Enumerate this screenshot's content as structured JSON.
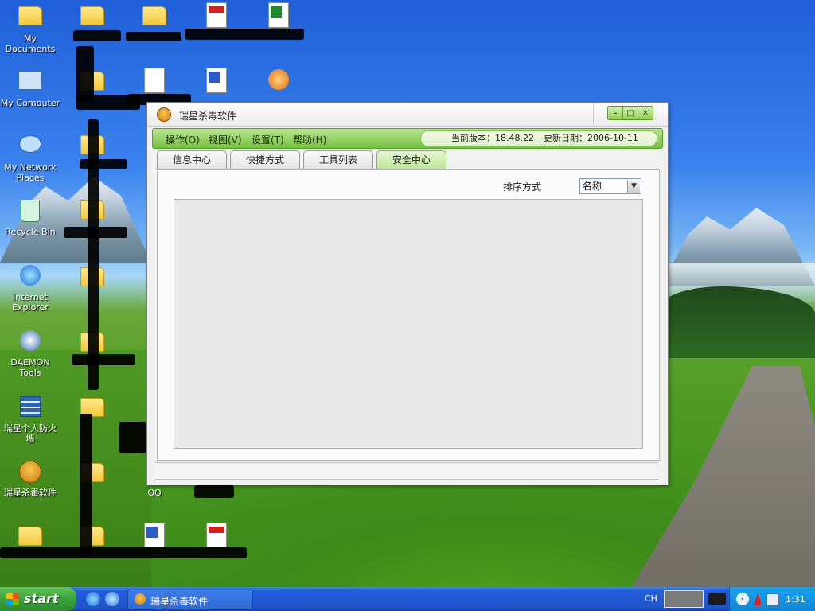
{
  "desktop": {
    "icons": [
      {
        "label": "My Documents"
      },
      {
        "label": "My Computer"
      },
      {
        "label": "My Network Places"
      },
      {
        "label": "Recycle Bin"
      },
      {
        "label": "Internet Explorer"
      },
      {
        "label": "DAEMON Tools"
      },
      {
        "label": "瑞星个人防火墙"
      },
      {
        "label": "瑞星杀毒软件"
      },
      {
        "label": "QQ"
      }
    ]
  },
  "window": {
    "title": "瑞星杀毒软件",
    "menu": [
      "操作(O)",
      "视图(V)",
      "设置(T)",
      "帮助(H)"
    ],
    "version_label": "当前版本：18.48.22",
    "update_label": "更新日期：2006-10-11",
    "tabs": [
      "信息中心",
      "快捷方式",
      "工具列表",
      "安全中心"
    ],
    "active_tab": "安全中心",
    "sort_label": "排序方式",
    "sort_value": "名称"
  },
  "taskbar": {
    "start_label": "start",
    "task_label": "瑞星杀毒软件",
    "ime": "CH",
    "clock": "1:31"
  },
  "colors": {
    "accent_green": "#74c240",
    "taskbar_blue": "#245edb",
    "start_green": "#3aa33a"
  }
}
